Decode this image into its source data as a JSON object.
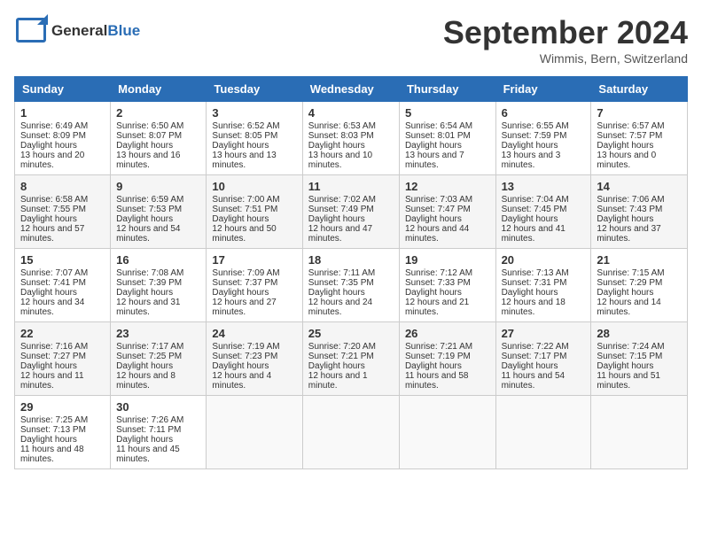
{
  "header": {
    "logo_general": "General",
    "logo_blue": "Blue",
    "title": "September 2024",
    "location": "Wimmis, Bern, Switzerland"
  },
  "columns": [
    "Sunday",
    "Monday",
    "Tuesday",
    "Wednesday",
    "Thursday",
    "Friday",
    "Saturday"
  ],
  "weeks": [
    [
      {
        "day": "1",
        "sunrise": "6:49 AM",
        "sunset": "8:09 PM",
        "daylight": "13 hours and 20 minutes."
      },
      {
        "day": "2",
        "sunrise": "6:50 AM",
        "sunset": "8:07 PM",
        "daylight": "13 hours and 16 minutes."
      },
      {
        "day": "3",
        "sunrise": "6:52 AM",
        "sunset": "8:05 PM",
        "daylight": "13 hours and 13 minutes."
      },
      {
        "day": "4",
        "sunrise": "6:53 AM",
        "sunset": "8:03 PM",
        "daylight": "13 hours and 10 minutes."
      },
      {
        "day": "5",
        "sunrise": "6:54 AM",
        "sunset": "8:01 PM",
        "daylight": "13 hours and 7 minutes."
      },
      {
        "day": "6",
        "sunrise": "6:55 AM",
        "sunset": "7:59 PM",
        "daylight": "13 hours and 3 minutes."
      },
      {
        "day": "7",
        "sunrise": "6:57 AM",
        "sunset": "7:57 PM",
        "daylight": "13 hours and 0 minutes."
      }
    ],
    [
      {
        "day": "8",
        "sunrise": "6:58 AM",
        "sunset": "7:55 PM",
        "daylight": "12 hours and 57 minutes."
      },
      {
        "day": "9",
        "sunrise": "6:59 AM",
        "sunset": "7:53 PM",
        "daylight": "12 hours and 54 minutes."
      },
      {
        "day": "10",
        "sunrise": "7:00 AM",
        "sunset": "7:51 PM",
        "daylight": "12 hours and 50 minutes."
      },
      {
        "day": "11",
        "sunrise": "7:02 AM",
        "sunset": "7:49 PM",
        "daylight": "12 hours and 47 minutes."
      },
      {
        "day": "12",
        "sunrise": "7:03 AM",
        "sunset": "7:47 PM",
        "daylight": "12 hours and 44 minutes."
      },
      {
        "day": "13",
        "sunrise": "7:04 AM",
        "sunset": "7:45 PM",
        "daylight": "12 hours and 41 minutes."
      },
      {
        "day": "14",
        "sunrise": "7:06 AM",
        "sunset": "7:43 PM",
        "daylight": "12 hours and 37 minutes."
      }
    ],
    [
      {
        "day": "15",
        "sunrise": "7:07 AM",
        "sunset": "7:41 PM",
        "daylight": "12 hours and 34 minutes."
      },
      {
        "day": "16",
        "sunrise": "7:08 AM",
        "sunset": "7:39 PM",
        "daylight": "12 hours and 31 minutes."
      },
      {
        "day": "17",
        "sunrise": "7:09 AM",
        "sunset": "7:37 PM",
        "daylight": "12 hours and 27 minutes."
      },
      {
        "day": "18",
        "sunrise": "7:11 AM",
        "sunset": "7:35 PM",
        "daylight": "12 hours and 24 minutes."
      },
      {
        "day": "19",
        "sunrise": "7:12 AM",
        "sunset": "7:33 PM",
        "daylight": "12 hours and 21 minutes."
      },
      {
        "day": "20",
        "sunrise": "7:13 AM",
        "sunset": "7:31 PM",
        "daylight": "12 hours and 18 minutes."
      },
      {
        "day": "21",
        "sunrise": "7:15 AM",
        "sunset": "7:29 PM",
        "daylight": "12 hours and 14 minutes."
      }
    ],
    [
      {
        "day": "22",
        "sunrise": "7:16 AM",
        "sunset": "7:27 PM",
        "daylight": "12 hours and 11 minutes."
      },
      {
        "day": "23",
        "sunrise": "7:17 AM",
        "sunset": "7:25 PM",
        "daylight": "12 hours and 8 minutes."
      },
      {
        "day": "24",
        "sunrise": "7:19 AM",
        "sunset": "7:23 PM",
        "daylight": "12 hours and 4 minutes."
      },
      {
        "day": "25",
        "sunrise": "7:20 AM",
        "sunset": "7:21 PM",
        "daylight": "12 hours and 1 minute."
      },
      {
        "day": "26",
        "sunrise": "7:21 AM",
        "sunset": "7:19 PM",
        "daylight": "11 hours and 58 minutes."
      },
      {
        "day": "27",
        "sunrise": "7:22 AM",
        "sunset": "7:17 PM",
        "daylight": "11 hours and 54 minutes."
      },
      {
        "day": "28",
        "sunrise": "7:24 AM",
        "sunset": "7:15 PM",
        "daylight": "11 hours and 51 minutes."
      }
    ],
    [
      {
        "day": "29",
        "sunrise": "7:25 AM",
        "sunset": "7:13 PM",
        "daylight": "11 hours and 48 minutes."
      },
      {
        "day": "30",
        "sunrise": "7:26 AM",
        "sunset": "7:11 PM",
        "daylight": "11 hours and 45 minutes."
      },
      null,
      null,
      null,
      null,
      null
    ]
  ],
  "labels": {
    "sunrise_prefix": "Sunrise: ",
    "sunset_prefix": "Sunset: ",
    "daylight_label": "Daylight hours"
  }
}
